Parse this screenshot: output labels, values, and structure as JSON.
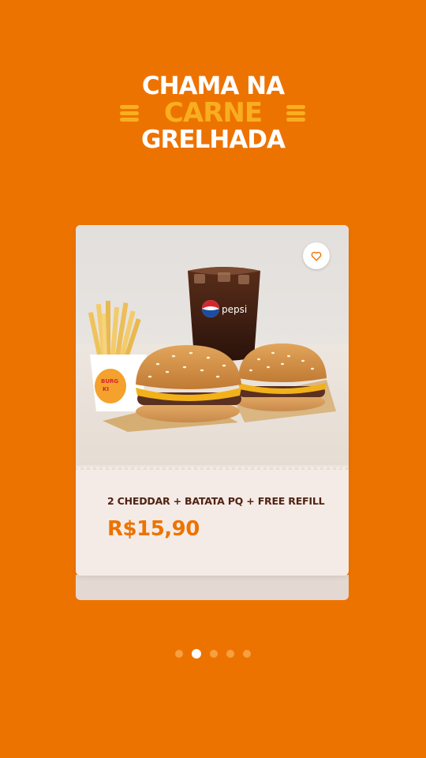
{
  "headline": {
    "line1": "CHAMA NA",
    "line2": "CARNE",
    "line3": "GRELHADA"
  },
  "card": {
    "product_name": "2 CHEDDAR + BATATA PQ + FREE REFILL",
    "price": "R$15,90",
    "favorite_icon": "heart-outline-icon",
    "image_texts": {
      "drink_brand": "pepsi",
      "fries_brand": "BURGER KING"
    }
  },
  "pagination": {
    "total": 5,
    "active_index": 1
  },
  "colors": {
    "background": "#ED7301",
    "accent_yellow": "#F8AE1F",
    "card_bg": "#F5EBE6",
    "text_brown": "#502314",
    "price_orange": "#ED7301"
  }
}
